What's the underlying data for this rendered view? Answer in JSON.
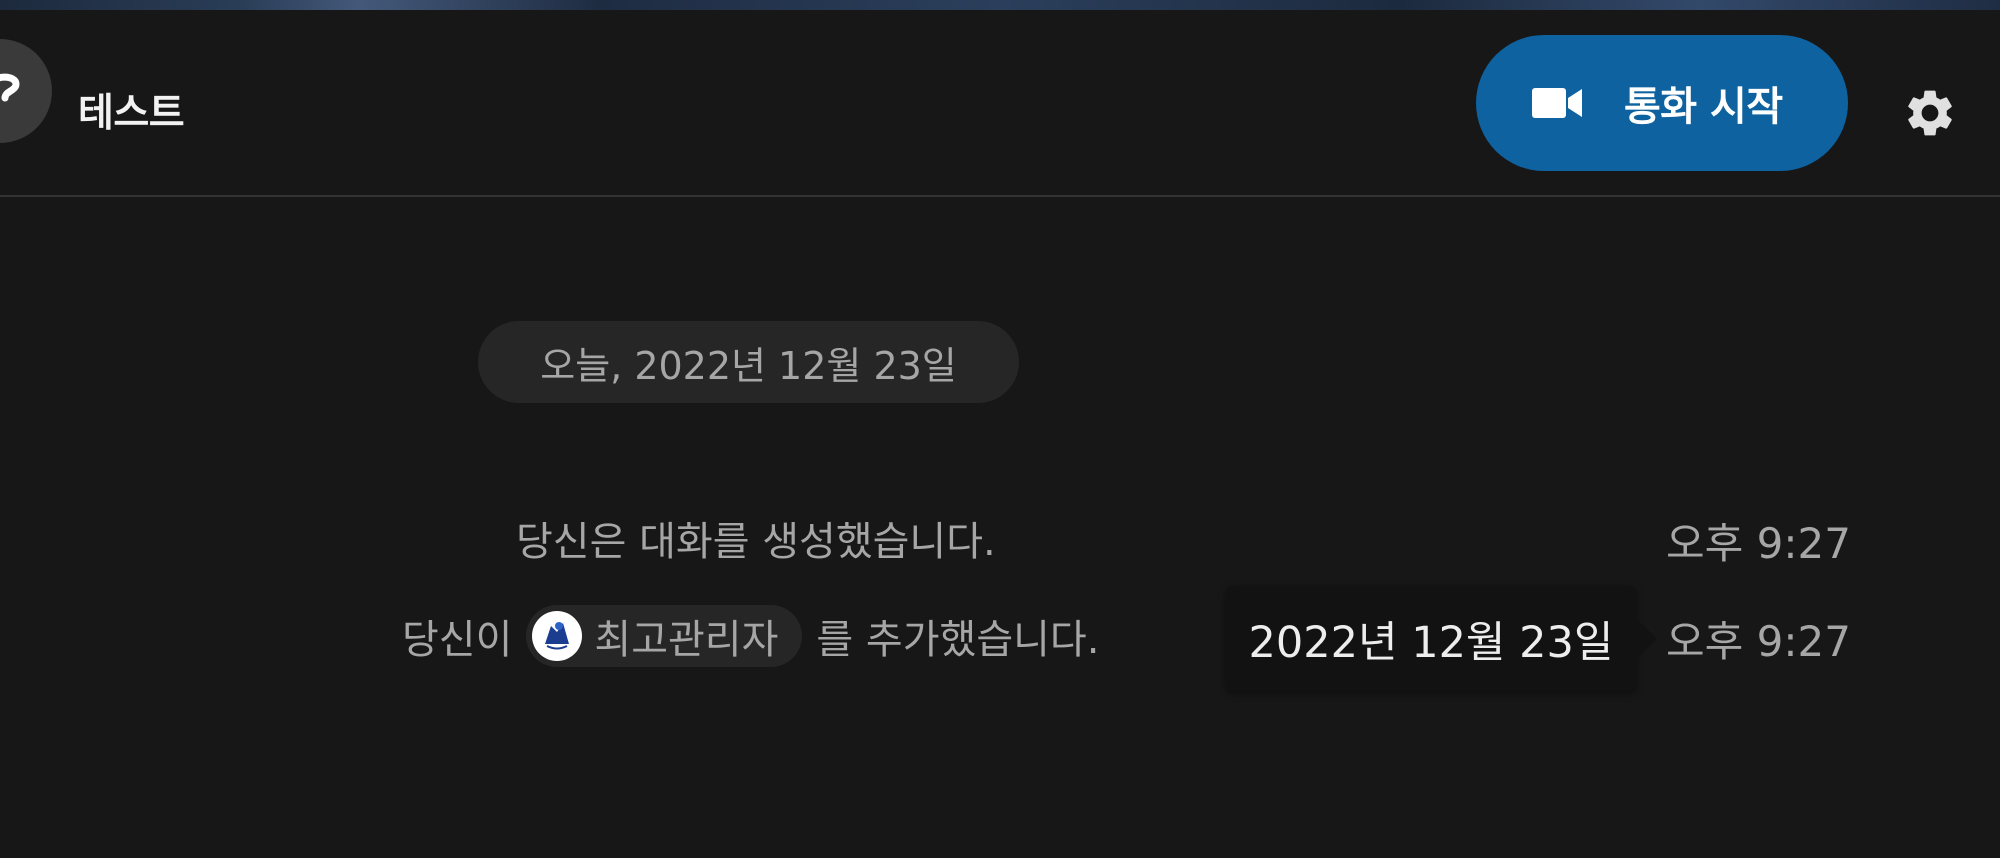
{
  "header": {
    "title": "테스트",
    "avatar_icon": "question-mark-icon",
    "call_button": {
      "label": "통화 시작",
      "icon": "video-camera-icon",
      "color": "#0e62a0"
    },
    "settings_icon": "gear-icon"
  },
  "timeline": {
    "date_separator": "오늘, 2022년 12월 23일",
    "events": [
      {
        "text": "당신은 대화를 생성했습니다.",
        "time": "오후 9:27"
      },
      {
        "prefix": "당신이",
        "mention": "최고관리자",
        "mention_avatar_icon": "user-avatar-icon",
        "suffix": "를 추가했습니다.",
        "time": "오후 9:27"
      }
    ],
    "tooltip": "2022년 12월 23일"
  }
}
